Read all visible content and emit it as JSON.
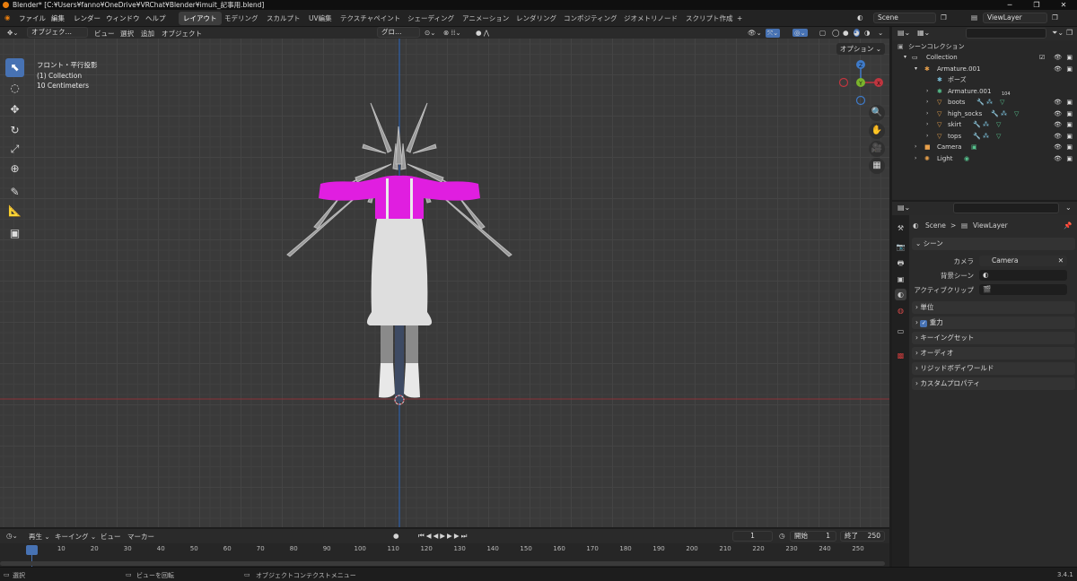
{
  "title": {
    "text": "Blender* [C:¥Users¥fanno¥OneDrive¥VRChat¥Blender¥imuit_記事用.blend]"
  },
  "window_controls": {
    "minimize": "─",
    "maximize": "❐",
    "close": "✕"
  },
  "menu": {
    "file": "ファイル",
    "edit": "編集",
    "render": "レンダー",
    "window": "ウィンドウ",
    "help": "ヘルプ"
  },
  "workspaces": [
    "レイアウト",
    "モデリング",
    "スカルプト",
    "UV編集",
    "テクスチャペイント",
    "シェーディング",
    "アニメーション",
    "レンダリング",
    "コンポジティング",
    "ジオメトリノード",
    "スクリプト作成"
  ],
  "workspace_add": "+",
  "scene": {
    "label": "Scene"
  },
  "viewlayer": {
    "label": "ViewLayer"
  },
  "viewport_header": {
    "mode": "オブジェク…",
    "view": "ビュー",
    "select": "選択",
    "add": "追加",
    "object": "オブジェクト",
    "transform": "グロ…"
  },
  "viewport_info": {
    "line1": "フロント・平行投影",
    "line2": "(1) Collection",
    "line3": "10 Centimeters"
  },
  "options": {
    "label": "オプション ⌄"
  },
  "gizmo": {
    "z": "Z",
    "y": "Y",
    "x": "X"
  },
  "outliner": {
    "search_placeholder": "",
    "root": "シーンコレクション",
    "items": [
      {
        "name": "Collection"
      },
      {
        "name": "Armature.001"
      },
      {
        "name": "ポーズ"
      },
      {
        "name": "Armature.001",
        "badge": "104"
      },
      {
        "name": "boots"
      },
      {
        "name": "high_socks"
      },
      {
        "name": "skirt"
      },
      {
        "name": "tops"
      },
      {
        "name": "Camera"
      },
      {
        "name": "Light"
      }
    ]
  },
  "properties": {
    "breadcrumb_scene": "Scene",
    "breadcrumb_sep": ">",
    "breadcrumb_layer": "ViewLayer",
    "section": "シーン",
    "camera_label": "カメラ",
    "camera_value": "Camera",
    "bg_scene_label": "背景シーン",
    "active_clip_label": "アクティブクリップ",
    "panels": [
      "単位",
      "重力",
      "キーイングセット",
      "オーディオ",
      "リジッドボディワールド",
      "カスタムプロパティ"
    ]
  },
  "timeline": {
    "play": "再生 ⌄",
    "keying": "キーイング ⌄",
    "view": "ビュー",
    "marker": "マーカー",
    "current_frame": "1",
    "start_label": "開始",
    "start": "1",
    "end_label": "終了",
    "end": "250",
    "ruler": [
      "1",
      "10",
      "20",
      "30",
      "40",
      "50",
      "60",
      "70",
      "80",
      "90",
      "100",
      "110",
      "120",
      "130",
      "140",
      "150",
      "160",
      "170",
      "180",
      "190",
      "200",
      "210",
      "220",
      "230",
      "240",
      "250"
    ]
  },
  "status": {
    "select": "選択",
    "rotate": "ビューを回転",
    "context": "オブジェクトコンテクストメニュー",
    "version": "3.4.1"
  },
  "colors": {
    "accent": "#4772b3",
    "tops": "#e01ee0",
    "skirt": "#d9d9d9",
    "x_axis": "#c0353f",
    "y_axis": "#7ab32c",
    "z_axis": "#3e7ac8"
  }
}
